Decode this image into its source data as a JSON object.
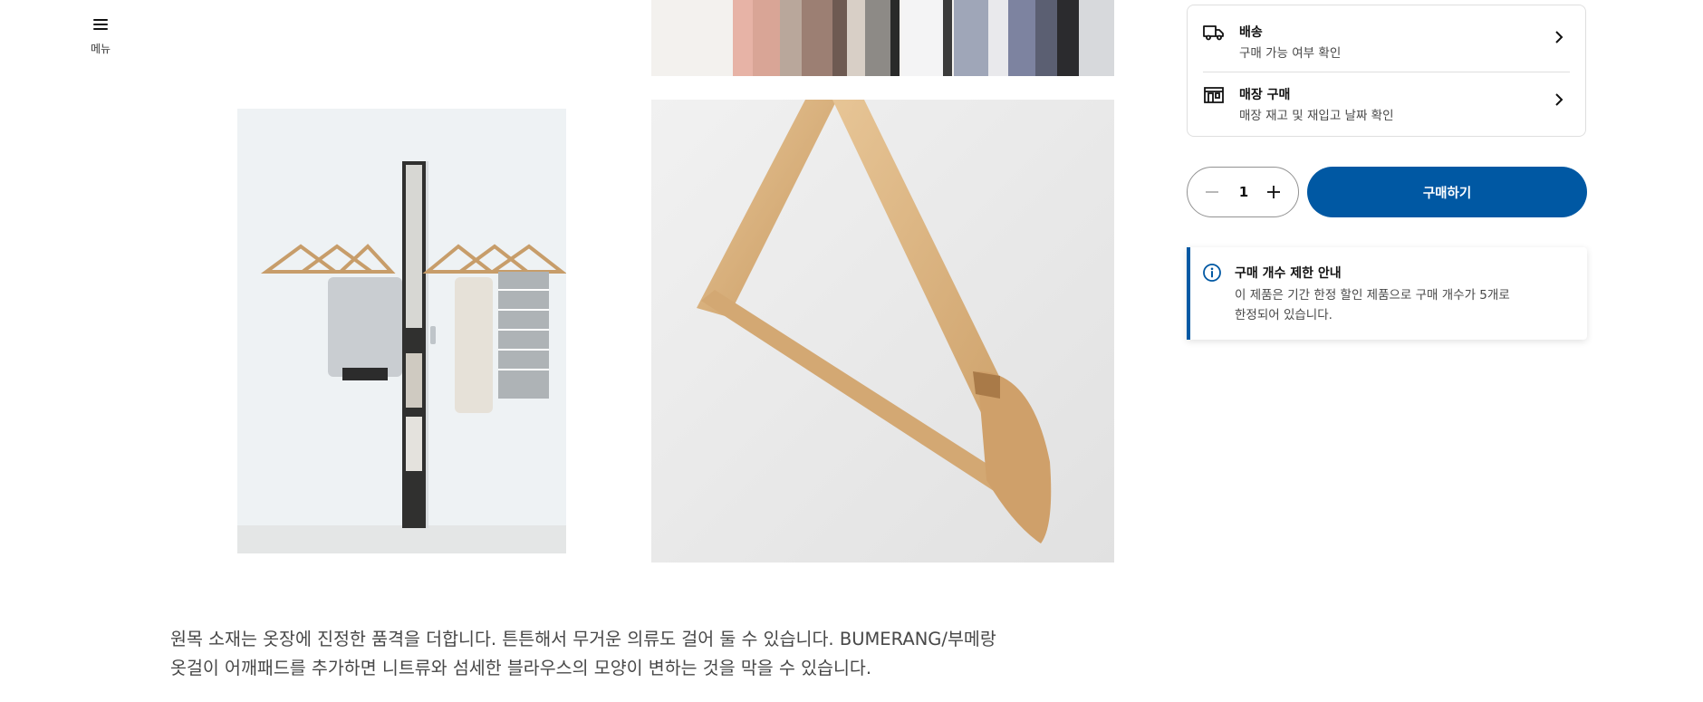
{
  "menu": {
    "label": "메뉴",
    "icon": "hamburger-icon"
  },
  "gallery": {
    "images": [
      {
        "alt": "옷장 속 옷걸이에 걸린 의류"
      },
      {
        "alt": "흰 옷장 문 옆 벽에 걸린 원목 옷걸이"
      },
      {
        "alt": "원목 옷걸이 클로즈업"
      }
    ]
  },
  "description": {
    "line1": "원목 소재는 옷장에 진정한 품격을 더합니다. 튼튼해서 무거운 의류도 걸어 둘 수 있습니다. BUMERANG/부메랑",
    "line2": "옷걸이 어깨패드를 추가하면 니트류와 섬세한 블라우스의 모양이 변하는 것을 막을 수 있습니다."
  },
  "availability": {
    "delivery": {
      "title": "배송",
      "subtitle": "구매 가능 여부 확인",
      "icon": "truck-icon"
    },
    "store": {
      "title": "매장 구매",
      "subtitle": "매장 재고 및 재입고 날짜 확인",
      "icon": "store-icon"
    }
  },
  "quantity": {
    "value": "1"
  },
  "buy_button": {
    "label": "구매하기"
  },
  "notice": {
    "title": "구매 개수 제한 안내",
    "body_line1": "이 제품은 기간 한정 할인 제품으로 구매 개수가 5개로",
    "body_line2": "한정되어 있습니다.",
    "icon": "info-icon"
  },
  "colors": {
    "accent": "#0058a3",
    "text": "#111111",
    "muted": "#484848"
  }
}
